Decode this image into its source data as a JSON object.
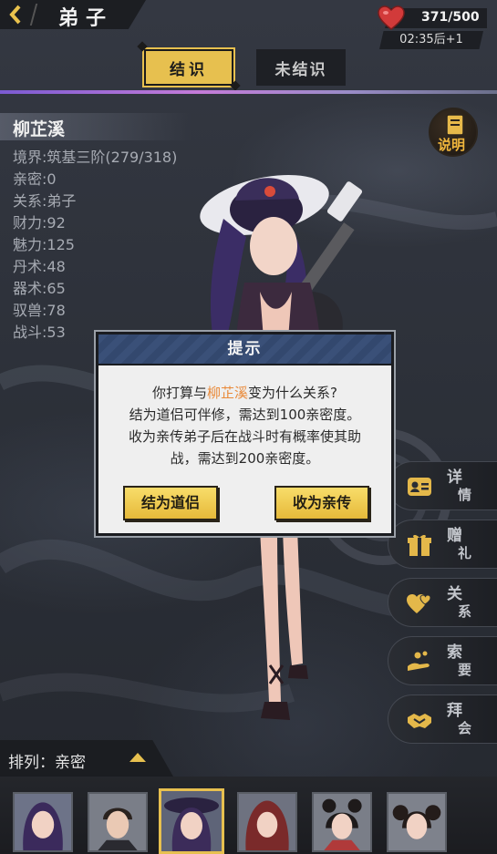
{
  "header": {
    "back_icon": "chevron-left-icon",
    "title": "弟子",
    "stamina": "371/500",
    "stamina_icon": "heart-icon",
    "timer": "02:35后+1"
  },
  "tabs": [
    {
      "label": "结识",
      "active": true
    },
    {
      "label": "未结识",
      "active": false
    }
  ],
  "character": {
    "name": "柳芷溪",
    "stats": [
      "境界:筑基三阶(279/318)",
      "亲密:0",
      "关系:弟子",
      "财力:92",
      "魅力:125",
      "丹术:48",
      "器术:65",
      "驭兽:78",
      "战斗:53"
    ]
  },
  "explain": {
    "icon": "book-icon",
    "label": "说明"
  },
  "side_buttons": [
    {
      "icon": "id-card-icon",
      "label": [
        "详",
        "情"
      ]
    },
    {
      "icon": "gift-icon",
      "label": [
        "赠",
        "礼"
      ]
    },
    {
      "icon": "hearts-icon",
      "label": [
        "关",
        "系"
      ]
    },
    {
      "icon": "hand-coins-icon",
      "label": [
        "索",
        "要"
      ]
    },
    {
      "icon": "handshake-icon",
      "label": [
        "拜",
        "会"
      ]
    }
  ],
  "dialog": {
    "title": "提示",
    "line1_before": "你打算与",
    "line1_name": "柳芷溪",
    "line1_after": "变为什么关系?",
    "line2": "结为道侣可伴修，需达到100亲密度。",
    "line3": "收为亲传弟子后在战斗时有概率使其助",
    "line4": "战，需达到200亲密度。",
    "btn_partner": "结为道侣",
    "btn_disciple": "收为亲传"
  },
  "sort": {
    "label": "排列：亲密",
    "icon": "triangle-up-icon"
  },
  "portraits": [
    {
      "name": "portrait-1",
      "selected": false,
      "hair": "#3b2a5c",
      "bg": "#6d7388"
    },
    {
      "name": "portrait-2",
      "selected": false,
      "hair": "#2a221e",
      "bg": "#7a7e88"
    },
    {
      "name": "portrait-3",
      "selected": true,
      "hair": "#3c2c5a",
      "bg": "#5e6478"
    },
    {
      "name": "portrait-4",
      "selected": false,
      "hair": "#7a2a2a",
      "bg": "#6e7280"
    },
    {
      "name": "portrait-5",
      "selected": false,
      "hair": "#1e1a1a",
      "bg": "#7a7e88"
    },
    {
      "name": "portrait-6",
      "selected": false,
      "hair": "#241c1a",
      "bg": "#7e828c"
    }
  ]
}
